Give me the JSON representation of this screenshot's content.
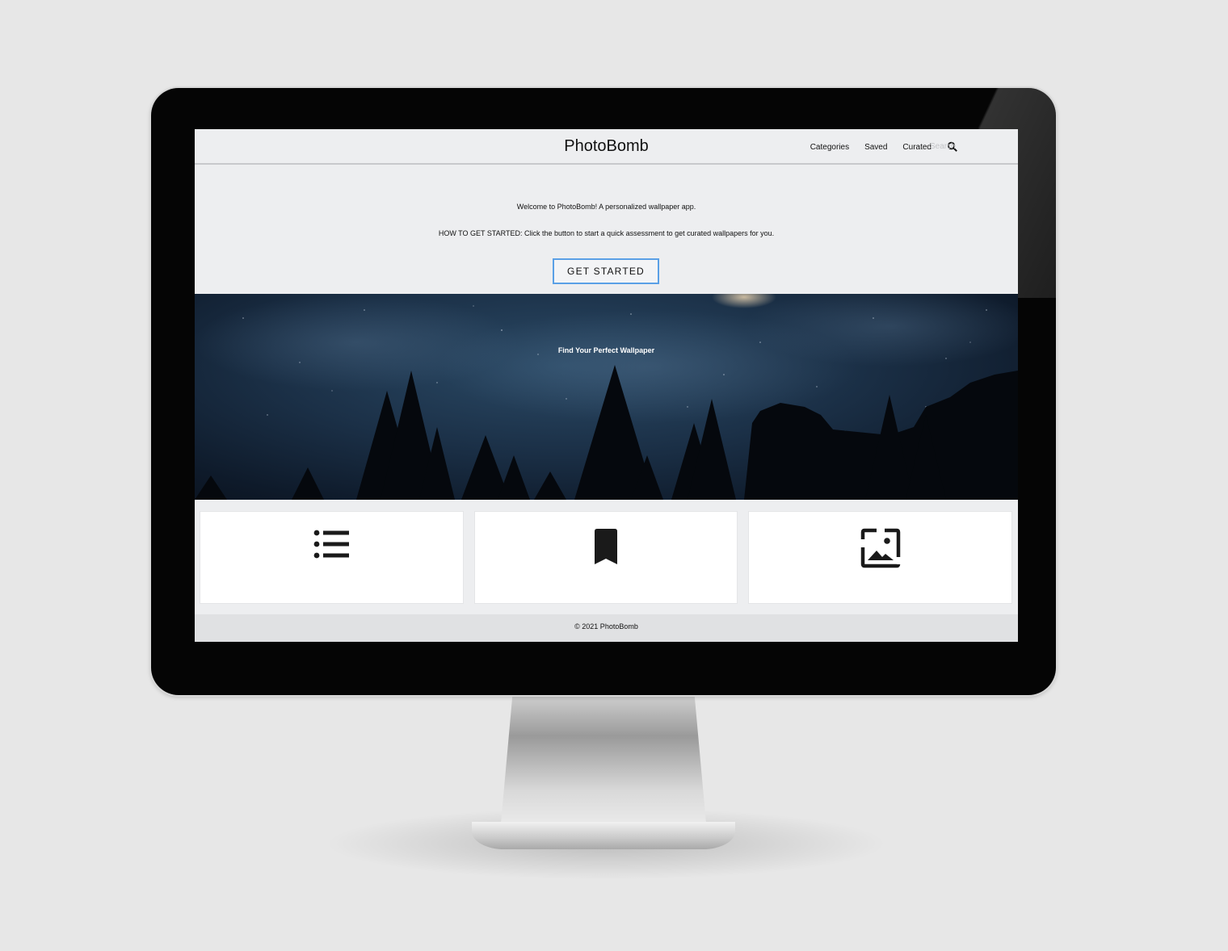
{
  "navbar": {
    "brand": "PhotoBomb",
    "links": [
      "Categories",
      "Saved",
      "Curated"
    ],
    "search_placeholder": "Search"
  },
  "intro": {
    "welcome": "Welcome to PhotoBomb! A personalized wallpaper app.",
    "howto": "HOW TO GET STARTED: Click the button to start a quick assessment to get curated wallpapers for you.",
    "cta_label": "GET STARTED"
  },
  "hero": {
    "title": "Find Your Perfect Wallpaper"
  },
  "cards": [
    {
      "icon": "list-icon"
    },
    {
      "icon": "bookmark-icon"
    },
    {
      "icon": "image-icon"
    }
  ],
  "footer": {
    "copyright": "© 2021 PhotoBomb"
  },
  "colors": {
    "accent": "#5aa0e6",
    "page_bg": "#edeef0",
    "footer_bg": "#e0e1e3",
    "hero_sky": "#1b3047"
  }
}
